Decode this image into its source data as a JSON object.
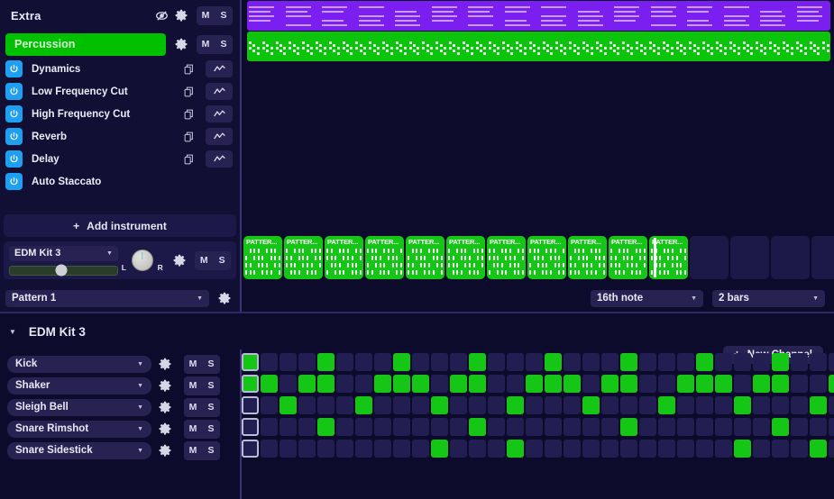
{
  "track_panel": {
    "header": {
      "title": "Extra",
      "hide_icon": "eye-off-icon",
      "gear_icon": "gear-icon",
      "mute_label": "M",
      "solo_label": "S"
    },
    "subtrack": {
      "name": "Percussion",
      "color": "#00c000",
      "gear_icon": "gear-icon",
      "mute_label": "M",
      "solo_label": "S"
    },
    "effects": [
      {
        "label": "Dynamics",
        "power": "power-icon",
        "copy": "copy-icon",
        "automation": "automation-icon",
        "has_automation": true
      },
      {
        "label": "Low Frequency Cut",
        "power": "power-icon",
        "copy": "copy-icon",
        "automation": "automation-icon",
        "has_automation": true
      },
      {
        "label": "High Frequency Cut",
        "power": "power-icon",
        "copy": "copy-icon",
        "automation": "automation-icon",
        "has_automation": true
      },
      {
        "label": "Reverb",
        "power": "power-icon",
        "copy": "copy-icon",
        "automation": "automation-icon",
        "has_automation": true
      },
      {
        "label": "Delay",
        "power": "power-icon",
        "copy": "copy-icon",
        "automation": "automation-icon",
        "has_automation": true
      },
      {
        "label": "Auto Staccato",
        "power": "power-icon",
        "copy": "",
        "automation": "",
        "has_automation": false
      }
    ],
    "add_instrument": {
      "label": "Add instrument",
      "plus": "+"
    },
    "instrument_strip": {
      "name": "EDM Kit 3",
      "volume_percent": 48,
      "pan_left_label": "L",
      "pan_right_label": "R",
      "gear_icon": "gear-icon",
      "mute_label": "M",
      "solo_label": "S"
    },
    "pattern_bar": {
      "pattern_name": "Pattern 1",
      "gear_icon": "gear-icon"
    }
  },
  "timeline": {
    "lanes": [
      {
        "name": "purple-midi-clip",
        "color": "#7b1ff0"
      },
      {
        "name": "green-midi-clip",
        "color": "#0bc40b"
      }
    ],
    "clips": [
      {
        "label": "PATTER...",
        "filled": true
      },
      {
        "label": "PATTER...",
        "filled": true
      },
      {
        "label": "PATTER...",
        "filled": true
      },
      {
        "label": "PATTER...",
        "filled": true
      },
      {
        "label": "PATTER...",
        "filled": true
      },
      {
        "label": "PATTER...",
        "filled": true
      },
      {
        "label": "PATTER...",
        "filled": true
      },
      {
        "label": "PATTER...",
        "filled": true
      },
      {
        "label": "PATTER...",
        "filled": true
      },
      {
        "label": "PATTER...",
        "filled": true
      },
      {
        "label": "PATTER...",
        "filled": true
      },
      {
        "label": "",
        "filled": false
      },
      {
        "label": "",
        "filled": false
      },
      {
        "label": "",
        "filled": false
      },
      {
        "label": "",
        "filled": false
      },
      {
        "label": "",
        "filled": false
      }
    ],
    "playhead_clip_index": 10
  },
  "toolbar": {
    "grid_resolution": "16th note",
    "length": "2 bars"
  },
  "sequencer": {
    "kit_name": "EDM Kit 3",
    "collapse_icon": "triangle-down-icon",
    "new_channel": {
      "label": "New Channel",
      "plus": "+"
    },
    "step_count": 32,
    "selected_step": 0,
    "channels": [
      {
        "name": "Kick",
        "gear_icon": "gear-icon",
        "mute_label": "M",
        "solo_label": "S",
        "steps": [
          0,
          4,
          8,
          12,
          16,
          20,
          24,
          28
        ]
      },
      {
        "name": "Shaker",
        "gear_icon": "gear-icon",
        "mute_label": "M",
        "solo_label": "S",
        "steps": [
          0,
          1,
          3,
          4,
          7,
          8,
          9,
          11,
          12,
          15,
          16,
          17,
          19,
          20,
          23,
          24,
          25,
          27,
          28,
          31
        ]
      },
      {
        "name": "Sleigh Bell",
        "gear_icon": "gear-icon",
        "mute_label": "M",
        "solo_label": "S",
        "steps": [
          2,
          6,
          10,
          14,
          18,
          22,
          26,
          30
        ]
      },
      {
        "name": "Snare Rimshot",
        "gear_icon": "gear-icon",
        "mute_label": "M",
        "solo_label": "S",
        "steps": [
          4,
          12,
          20,
          28
        ]
      },
      {
        "name": "Snare Sidestick",
        "gear_icon": "gear-icon",
        "mute_label": "M",
        "solo_label": "S",
        "steps": [
          10,
          14,
          26,
          30
        ]
      }
    ]
  },
  "colors": {
    "accent_green": "#16c616",
    "accent_purple": "#7b1ff0",
    "power_blue": "#1e9ff2",
    "panel_bg": "#120f35",
    "app_bg": "#0d0b2b"
  }
}
